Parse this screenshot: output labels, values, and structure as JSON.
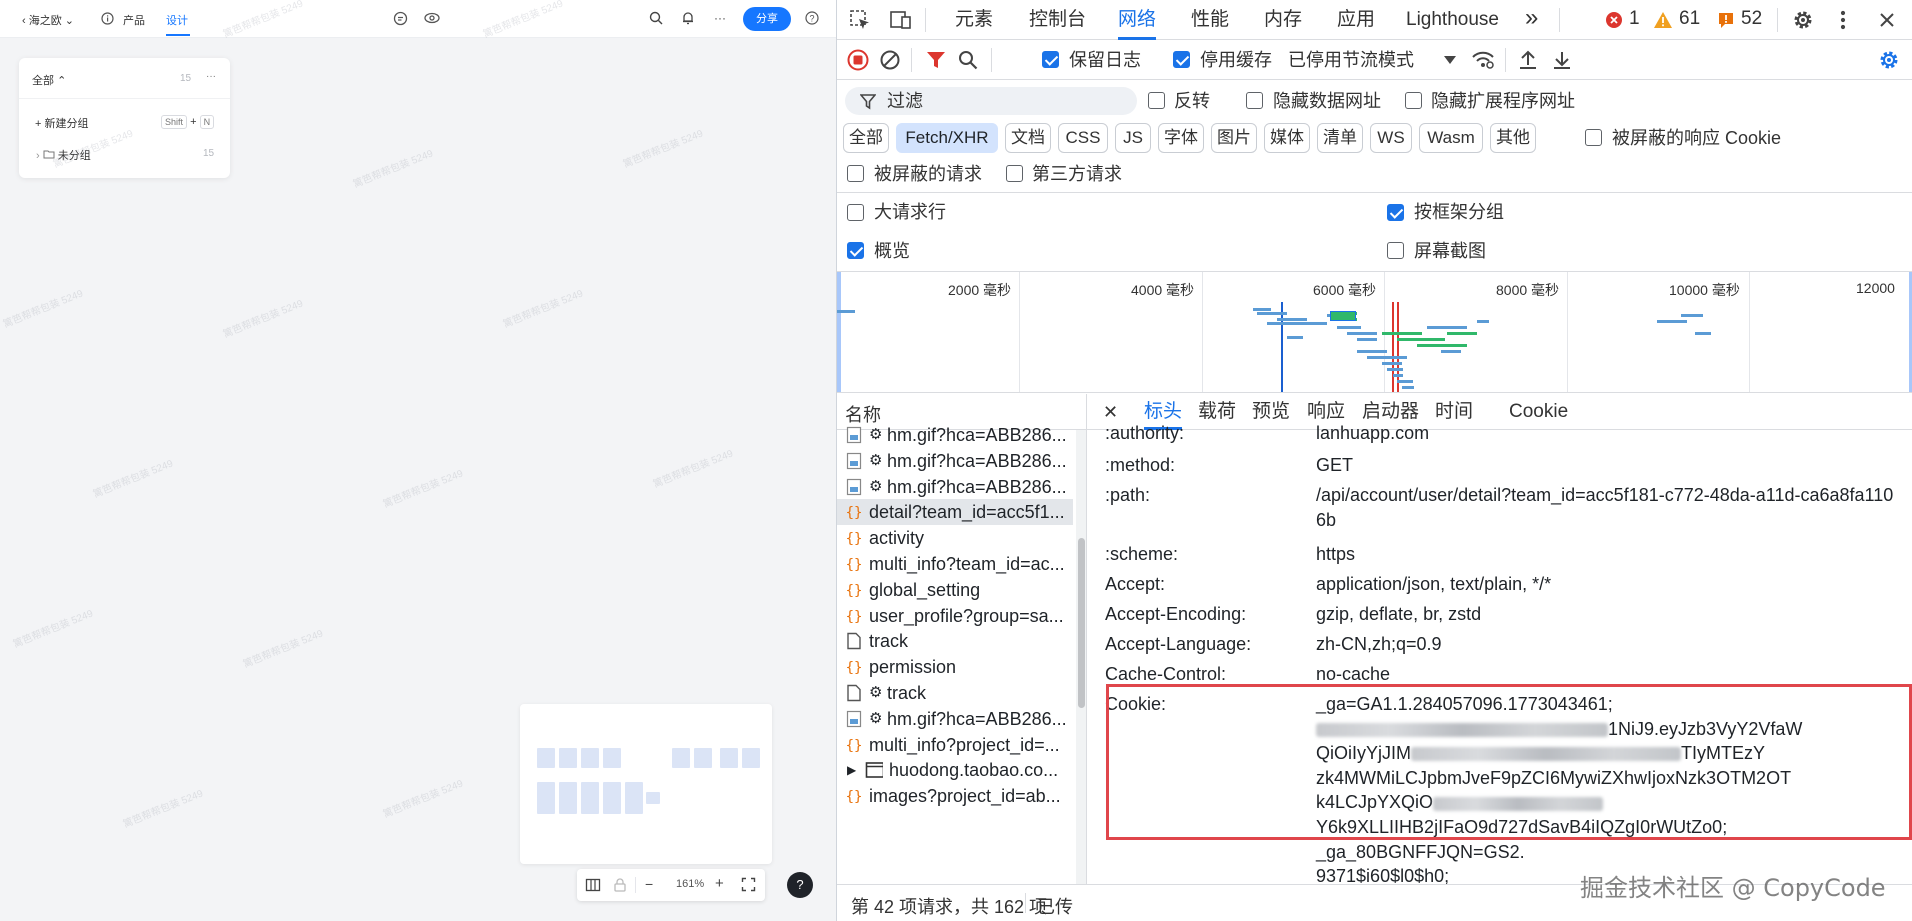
{
  "app": {
    "back_label": "海之欧",
    "nav_products": "产品",
    "nav_design": "设计",
    "share_label": "分享",
    "help_glyph": "?",
    "watermark_text": "篱笆帮帮包装 5249",
    "panel": {
      "header": "全部",
      "header_count": "15",
      "more_glyph": "···",
      "new_group_label": "新建分组",
      "shortcut_shift": "Shift",
      "shortcut_plus": "+",
      "shortcut_key": "N",
      "ungrouped_label": "未分组",
      "ungrouped_count": "15"
    },
    "zoom": {
      "minus": "−",
      "value": "161%",
      "plus": "+"
    }
  },
  "devtools": {
    "top_tabs": [
      "元素",
      "控制台",
      "网络",
      "性能",
      "内存",
      "应用",
      "Lighthouse"
    ],
    "active_top_tab": "网络",
    "more_tabs_glyph": "»",
    "errors_count": "1",
    "warnings_count": "61",
    "issues_count": "52",
    "toolbar": {
      "preserve_log": "保留日志",
      "disable_cache": "停用缓存",
      "throttle": "已停用节流模式"
    },
    "filter": {
      "placeholder": "过滤",
      "invert": "反转",
      "hide_data_urls": "隐藏数据网址",
      "hide_ext_urls": "隐藏扩展程序网址"
    },
    "type_chips": [
      "全部",
      "Fetch/XHR",
      "文档",
      "CSS",
      "JS",
      "字体",
      "图片",
      "媒体",
      "清单",
      "WS",
      "Wasm",
      "其他"
    ],
    "blocked_cookies": "被屏蔽的响应 Cookie",
    "blocked_requests": "被屏蔽的请求",
    "third_party": "第三方请求",
    "options": {
      "big_rows": "大请求行",
      "group_by_frame": "按框架分组",
      "overview": "概览",
      "screenshots": "屏幕截图"
    },
    "timeline_labels": [
      "2000 毫秒",
      "4000 毫秒",
      "6000 毫秒",
      "8000 毫秒",
      "10000 毫秒",
      "12000"
    ],
    "list_header": "名称",
    "requests": [
      "hm.gif?hca=ABB286...",
      "hm.gif?hca=ABB286...",
      "hm.gif?hca=ABB286...",
      "detail?team_id=acc5f1...",
      "activity",
      "multi_info?team_id=ac...",
      "global_setting",
      "user_profile?group=sa...",
      "track",
      "permission",
      "track",
      "hm.gif?hca=ABB286...",
      "multi_info?project_id=...",
      "huodong.taobao.co...",
      "images?project_id=ab..."
    ],
    "detail_tabs": [
      "标头",
      "载荷",
      "预览",
      "响应",
      "启动器",
      "时间",
      "Cookie"
    ],
    "close_glyph": "✕",
    "headers": [
      {
        "k": ":authority:",
        "v": "lanhuapp.com"
      },
      {
        "k": ":method:",
        "v": "GET"
      },
      {
        "k": ":path:",
        "v": "/api/account/user/detail?team_id=acc5f181-c772-48da-a11d-ca6a8fa1106b"
      },
      {
        "k": ":scheme:",
        "v": "https"
      },
      {
        "k": "Accept:",
        "v": "application/json, text/plain, */*"
      },
      {
        "k": "Accept-Encoding:",
        "v": "gzip, deflate, br, zstd"
      },
      {
        "k": "Accept-Language:",
        "v": "zh-CN,zh;q=0.9"
      },
      {
        "k": "Cache-Control:",
        "v": "no-cache"
      },
      {
        "k": "Cookie:",
        "v": ""
      }
    ],
    "cookie_lines": {
      "l1": "_ga=GA1.1.284057096.1773043461;",
      "l2": "1NiJ9.eyJzb3VyY2VfaW",
      "l3a": "QiOiIyYjJIM",
      "l3b": "TIyMTEzY",
      "l4": "zk4MWMiLCJpbmJveF9pZCI6MywiZXhwIjoxNzk3OTM2OT",
      "l5": "k4LCJpYXQiO",
      "l6": "Y6k9XLLIIHB2jIFaO9d727dSavB4iIQZgI0rWUtZo0;",
      "l7": "_ga_80BGNFFJQN=GS2.",
      "l8": "9371$i60$l0$h0;"
    },
    "status_count": "第 42 项请求，共 162 项",
    "status_transferred": "已传",
    "corner_watermark": "掘金技术社区 @ CopyCode"
  }
}
